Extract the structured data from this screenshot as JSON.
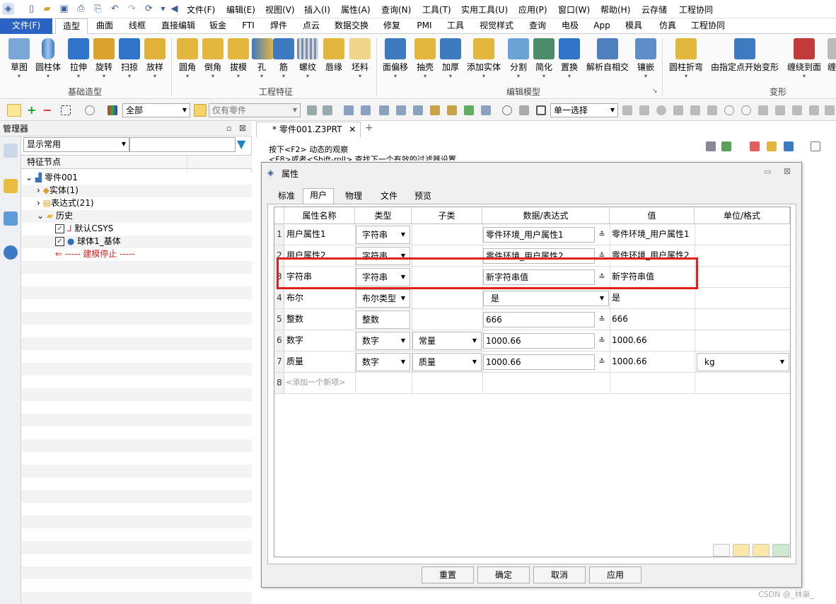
{
  "menubar": {
    "items": [
      "文件(F)",
      "编辑(E)",
      "视图(V)",
      "插入(I)",
      "属性(A)",
      "查询(N)",
      "工具(T)",
      "实用工具(U)",
      "应用(P)",
      "窗口(W)",
      "帮助(H)",
      "云存储",
      "工程协同"
    ]
  },
  "tabs": [
    "文件(F)",
    "造型",
    "曲面",
    "线框",
    "直接编辑",
    "钣金",
    "FTI",
    "焊件",
    "点云",
    "数据交换",
    "修复",
    "PMI",
    "工具",
    "视觉样式",
    "查询",
    "电极",
    "App",
    "模具",
    "仿真",
    "工程协同"
  ],
  "ribbon": {
    "basic": [
      "草图",
      "圆柱体",
      "拉伸",
      "旋转",
      "扫掠",
      "放样"
    ],
    "eng": [
      "圆角",
      "倒角",
      "拔模",
      "孔",
      "筋",
      "螺纹",
      "唇缘",
      "坯料"
    ],
    "edit": [
      "面偏移",
      "抽壳",
      "加厚",
      "添加实体",
      "分割",
      "简化",
      "置换",
      "解析自相交",
      "镶嵌"
    ],
    "deform": [
      "圆柱折弯",
      "由指定点开始变形",
      "缠绕到面",
      "缠"
    ],
    "groups": [
      "基础造型",
      "工程特征",
      "编辑模型",
      "变形"
    ]
  },
  "toolbar": {
    "filter_all": "全部",
    "parts_only": "仅有零件",
    "selection": "单一选择"
  },
  "manager": {
    "title": "管理器",
    "display": "显示常用",
    "col": "特征节点",
    "tree": {
      "root": "零件001",
      "solid": "实体(1)",
      "expr": "表达式(21)",
      "history": "历史",
      "csys": "默认CSYS",
      "sphere": "球体1_基体",
      "stop": "----- 建模停止 -----"
    }
  },
  "doc": {
    "tab": "* 零件001.Z3PRT",
    "hint1": "按下<F2> 动态的观察",
    "hint2": "<F8>或者<Shift-roll> 查找下一个有效的过滤器设置"
  },
  "dialog": {
    "title": "属性",
    "tabs": [
      "标准",
      "用户",
      "物理",
      "文件",
      "预览"
    ],
    "headers": [
      "属性名称",
      "类型",
      "子类",
      "数据/表达式",
      "值",
      "单位/格式"
    ],
    "rows": [
      {
        "n": "1",
        "name": "用户属性1",
        "type": "字符串",
        "sub": "",
        "data": "零件环境_用户属性1",
        "value": "零件环境_用户属性1",
        "unit": ""
      },
      {
        "n": "2",
        "name": "用户属性2",
        "type": "字符串",
        "sub": "",
        "data": "零件环境_用户属性2",
        "value": "零件环境_用户属性2",
        "unit": ""
      },
      {
        "n": "3",
        "name": "字符串",
        "type": "字符串",
        "sub": "",
        "data": "新字符串值",
        "value": "新字符串值",
        "unit": ""
      },
      {
        "n": "4",
        "name": "布尔",
        "type": "布尔类型",
        "sub": "",
        "data": "是",
        "value": "是",
        "unit": ""
      },
      {
        "n": "5",
        "name": "整数",
        "type": "整数",
        "sub": "",
        "data": "666",
        "value": "666",
        "unit": ""
      },
      {
        "n": "6",
        "name": "数字",
        "type": "数字",
        "sub": "常量",
        "data": "1000.66",
        "value": "1000.66",
        "unit": ""
      },
      {
        "n": "7",
        "name": "质量",
        "type": "数字",
        "sub": "质量",
        "data": "1000.66",
        "value": "1000.66",
        "unit": "kg"
      }
    ],
    "add_row_n": "8",
    "add_row": "<添加一个新项>",
    "buttons": [
      "重置",
      "确定",
      "取消",
      "应用"
    ]
  },
  "watermark": "CSDN @_林枭_",
  "colors": {
    "accent": "#2b63c4",
    "highlight": "#e0201d"
  }
}
